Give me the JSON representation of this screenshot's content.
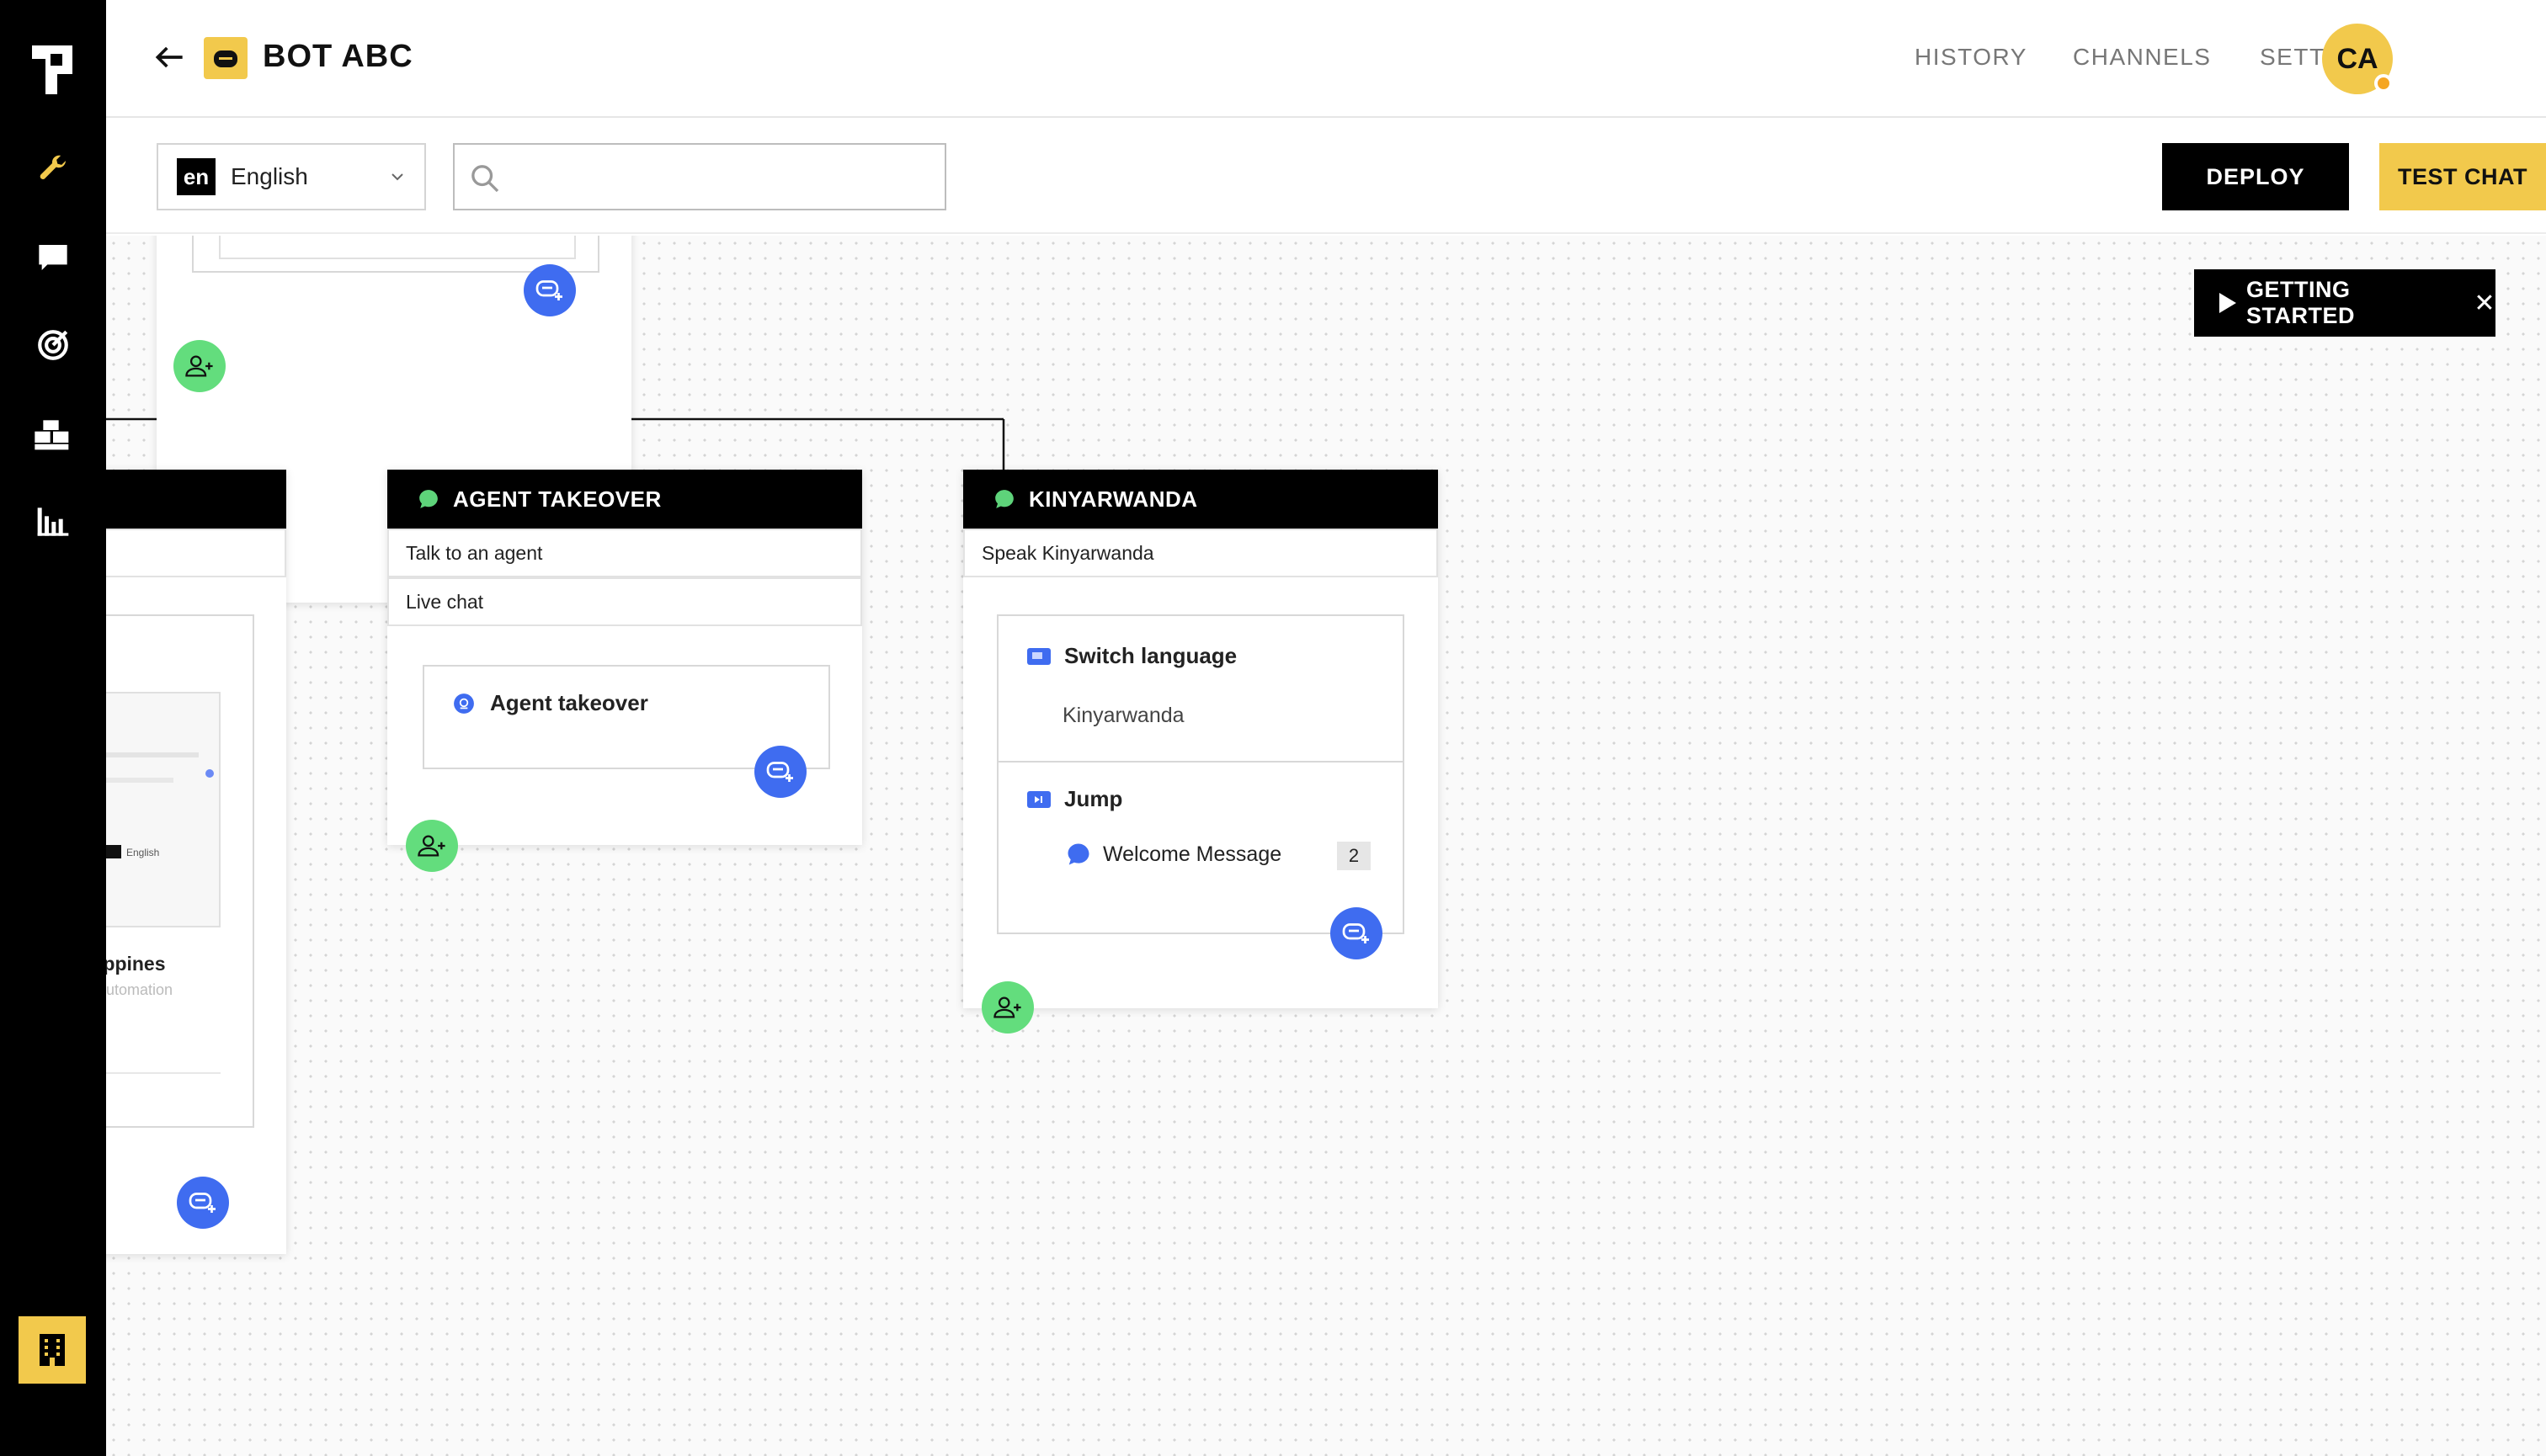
{
  "sidebar": {
    "icons": [
      "wrench-icon",
      "chat-icon",
      "target-icon",
      "integrations-icon",
      "analytics-icon"
    ],
    "bottom_icon": "building-icon"
  },
  "header": {
    "bot_name": "BOT ABC",
    "nav": [
      "HISTORY",
      "CHANNELS",
      "SETTINGS"
    ],
    "avatar_initials": "CA"
  },
  "toolbar": {
    "language_code": "en",
    "language_label": "English",
    "search_placeholder": "",
    "deploy_label": "DEPLOY",
    "test_chat_label": "TEST CHAT"
  },
  "canvas": {
    "getting_started_label": "GETTING STARTED",
    "getting_started_close": "✕",
    "cards": {
      "partial": {
        "preview_lang": "English",
        "preview_title": "ippines",
        "preview_sub": "automation"
      },
      "agent_takeover": {
        "title": "AGENT TAKEOVER",
        "intents": [
          "Talk to an agent",
          "Live chat"
        ],
        "step": "Agent takeover"
      },
      "kinyarwanda": {
        "title": "KINYARWANDA",
        "intents": [
          "Speak Kinyarwanda"
        ],
        "switch_title": "Switch language",
        "switch_value": "Kinyarwanda",
        "jump_title": "Jump",
        "jump_target": "Welcome Message",
        "jump_count": "2"
      }
    }
  },
  "colors": {
    "accent_yellow": "#f2c94c",
    "blue": "#3f6cf0",
    "green": "#63dd7d",
    "sidebar": "#000000"
  }
}
